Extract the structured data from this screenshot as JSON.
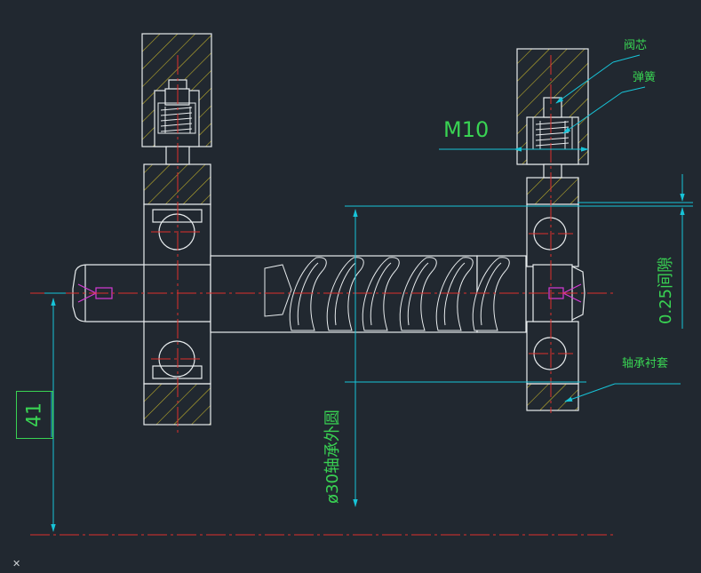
{
  "annotations": {
    "m10": "M10",
    "valve_core": "阀芯",
    "spring": "弹簧",
    "bearing_bushing": "轴承衬套",
    "diameter_label": "ø30轴承外圆",
    "tolerance_label": "0.25间隙",
    "dimension_41": "41"
  },
  "colors": {
    "background": "#212830",
    "outline": "#e8ecee",
    "hatch": "#c9b82a",
    "centerline": "#e0302d",
    "dimension": "#17c4d8",
    "annotation_text": "#39d353",
    "pin": "#d63bd6"
  }
}
